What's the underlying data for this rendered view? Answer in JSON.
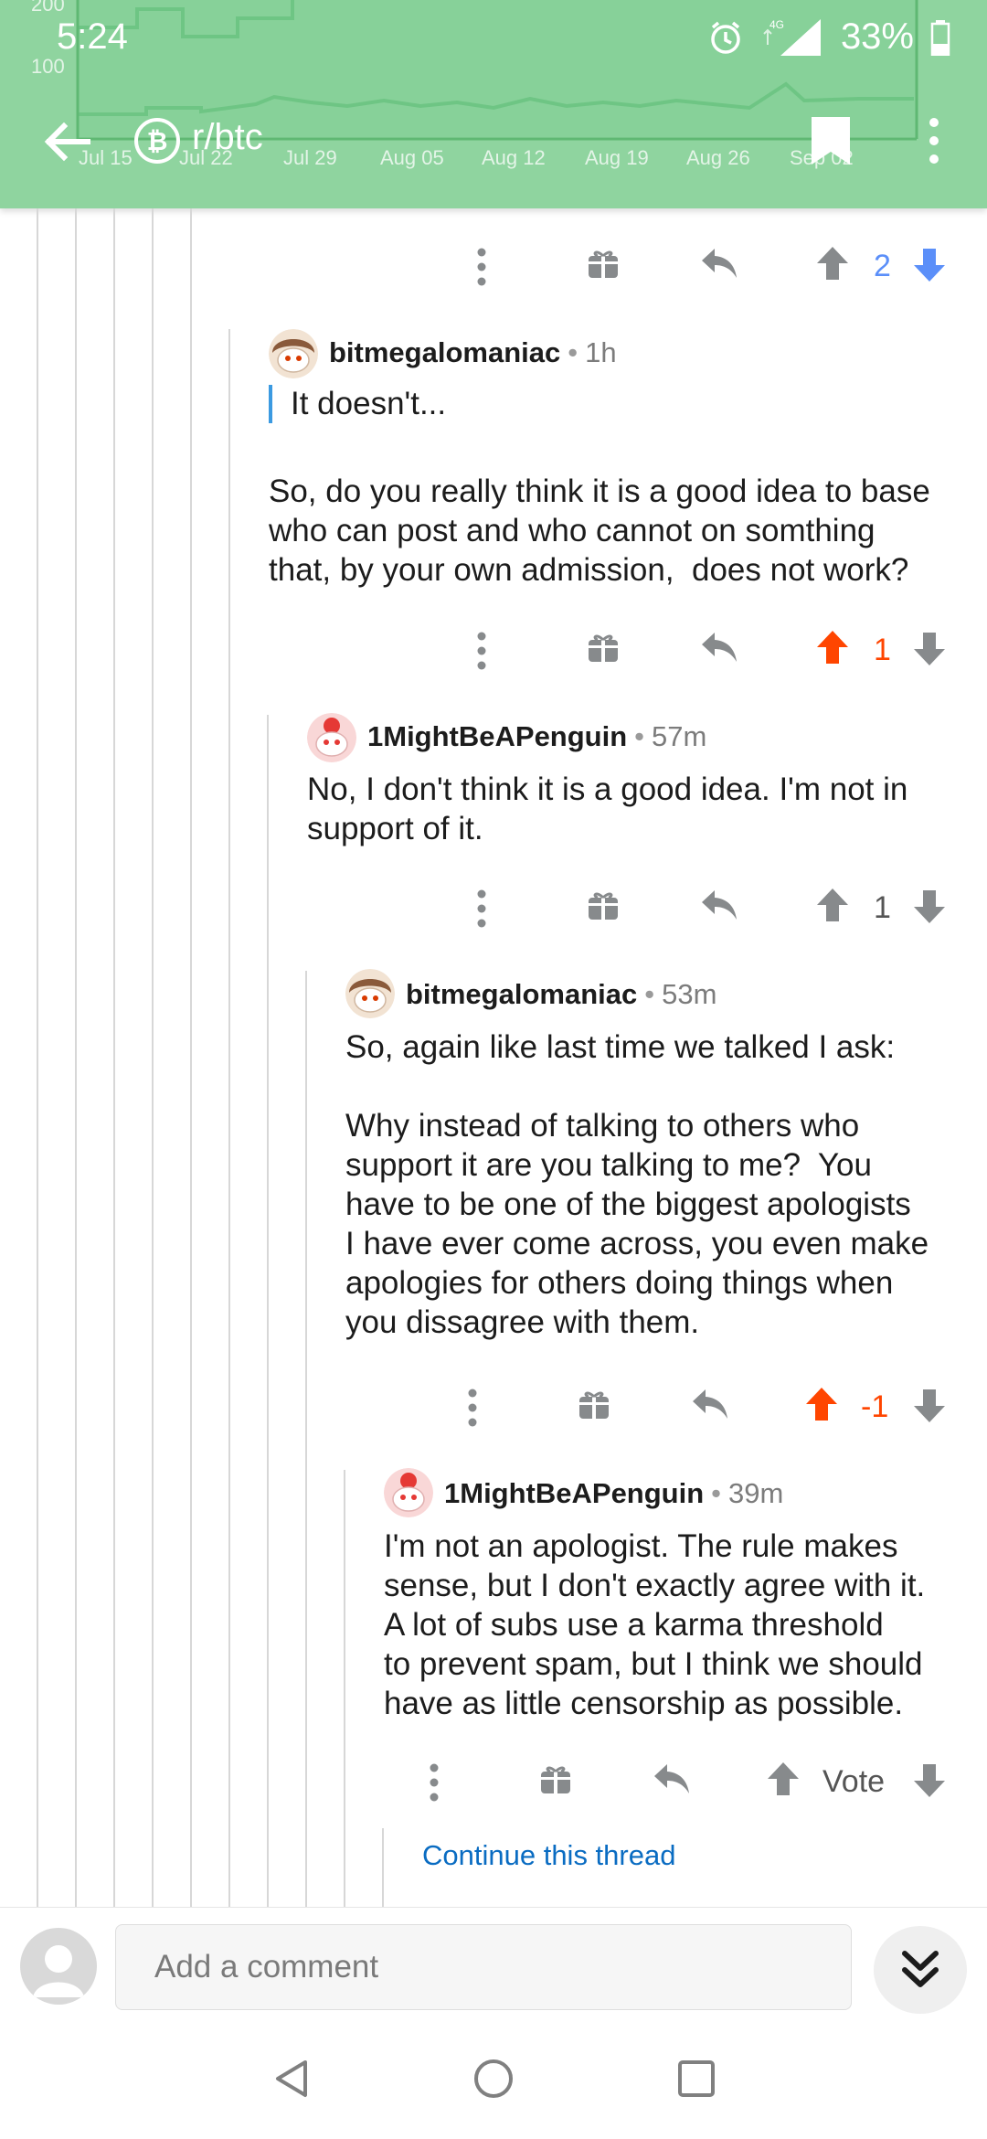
{
  "status_bar": {
    "time": "5:24",
    "network": "4G",
    "battery": "33%"
  },
  "header": {
    "title": "r/btc",
    "back_icon": "arrow-left-icon",
    "subreddit_icon": "bitcoin-cash-icon",
    "bookmark_icon": "bookmark-icon",
    "more_icon": "more-vertical-icon",
    "background_chart": {
      "x_labels": [
        "Jul 15",
        "Jul 22",
        "Jul 29",
        "Aug 05",
        "Aug 12",
        "Aug 19",
        "Aug 26",
        "Sep 02"
      ],
      "y_labels": [
        "200",
        "100"
      ]
    },
    "color": "#8fd49f"
  },
  "thread": {
    "top_vote_row": {
      "score": "2",
      "state": "downvoted"
    },
    "comments": [
      {
        "author": "bitmegalomaniac",
        "age": "1h",
        "quote": "It doesn't...",
        "body": "So, do you really think it is a good idea to base\nwho can post and who cannot on somthing\nthat, by your own admission,  does not work?",
        "score": "1",
        "state": "upvoted"
      },
      {
        "author": "1MightBeAPenguin",
        "age": "57m",
        "body": "No, I don't think it is a good idea. I'm not in\nsupport of it.",
        "score": "1",
        "state": "none"
      },
      {
        "author": "bitmegalomaniac",
        "age": "53m",
        "body": "So, again like last time we talked I ask:\n\nWhy instead of talking to others who\nsupport it are you talking to me?  You\nhave to be one of the biggest apologists\nI have ever come across, you even make\napologies for others doing things when\nyou dissagree with them.",
        "score": "-1",
        "state": "upvoted"
      },
      {
        "author": "1MightBeAPenguin",
        "age": "39m",
        "body": "I'm not an apologist. The rule makes\nsense, but I don't exactly agree with it.\nA lot of subs use a karma threshold\nto prevent spam, but I think we should\nhave as little censorship as possible.",
        "score": "Vote",
        "state": "none"
      }
    ],
    "continue_label": "Continue this thread"
  },
  "composer": {
    "placeholder": "Add a comment",
    "collapse_icon": "double-chevron-down-icon"
  },
  "navbar": {
    "back_icon": "nav-back-icon",
    "home_icon": "nav-home-icon",
    "recents_icon": "nav-recents-icon"
  },
  "colors": {
    "upvote": "#ff4500",
    "downvote": "#5b8ff9",
    "neutral": "#878a8c",
    "link": "#0a6cc2"
  }
}
